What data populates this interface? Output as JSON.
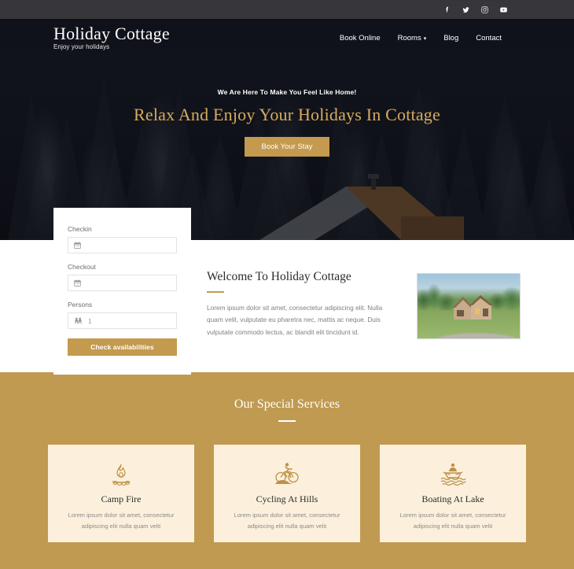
{
  "topbar": {
    "social": [
      {
        "name": "facebook-icon",
        "label": "Facebook"
      },
      {
        "name": "twitter-icon",
        "label": "Twitter"
      },
      {
        "name": "instagram-icon",
        "label": "Instagram"
      },
      {
        "name": "youtube-icon",
        "label": "YouTube"
      }
    ]
  },
  "brand": {
    "title": "Holiday Cottage",
    "tagline": "Enjoy your holidays"
  },
  "nav": {
    "items": [
      {
        "label": "Book Online",
        "has_dropdown": false
      },
      {
        "label": "Rooms",
        "has_dropdown": true,
        "caret": "▾"
      },
      {
        "label": "Blog",
        "has_dropdown": false
      },
      {
        "label": "Contact",
        "has_dropdown": false
      }
    ]
  },
  "hero": {
    "eyebrow": "We Are Here To Make You Feel Like Home!",
    "title": "Relax And Enjoy Your Holidays In Cottage",
    "button_label": "Book Your Stay",
    "background": "snowy-pine-forest-with-cabin"
  },
  "booking": {
    "checkin_label": "Checkin",
    "checkin_value": "",
    "checkin_placeholder": "",
    "checkout_label": "Checkout",
    "checkout_value": "",
    "checkout_placeholder": "",
    "persons_label": "Persons",
    "persons_value": "1",
    "submit_label": "Check availabilities"
  },
  "welcome": {
    "title": "Welcome To Holiday Cottage",
    "body": "Lorem ipsum dolor sit amet, consectetur adipiscing elit. Nulla quam velit, vulputate eu pharetra nec, mattis ac neque. Duis vulputate commodo lectus, ac blandit elit tincidunt id.",
    "image_alt": "stone-cottage-house-with-driveway"
  },
  "services": {
    "title": "Our Special Services",
    "cards": [
      {
        "icon": "campfire-icon",
        "title": "Camp Fire",
        "text": "Lorem ipsum dolor sit amet, consectetur adipiscing elit nulla quam velit"
      },
      {
        "icon": "cycling-icon",
        "title": "Cycling At Hills",
        "text": "Lorem ipsum dolor sit amet, consectetur adipiscing elit nulla quam velit"
      },
      {
        "icon": "boating-icon",
        "title": "Boating At Lake",
        "text": "Lorem ipsum dolor sit amet, consectetur adipiscing elit nulla quam velit"
      }
    ]
  },
  "colors": {
    "gold": "#c09a50",
    "gold_button": "#c49a4f",
    "hero_title": "#d8ab5d",
    "card_bg": "#fcf0dc",
    "topbar": "#3a3a3e",
    "hero_dark": "#101118"
  }
}
